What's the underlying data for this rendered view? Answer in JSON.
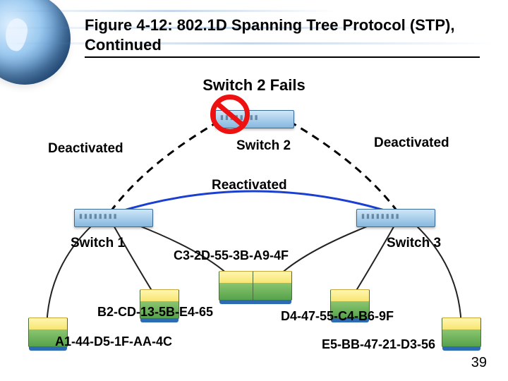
{
  "title": "Figure 4-12: 802.1D Spanning Tree Protocol (STP), Continued",
  "heading": "Switch 2 Fails",
  "labels": {
    "deactivated_left": "Deactivated",
    "deactivated_right": "Deactivated",
    "reactivated": "Reactivated",
    "switch1": "Switch 1",
    "switch2": "Switch 2",
    "switch3": "Switch 3"
  },
  "mac": {
    "center": "C3-2D-55-3B-A9-4F",
    "left_mid": "B2-CD-13-5B-E4-65",
    "right_mid": "D4-47-55-C4-B6-9F",
    "left_low": "A1-44-D5-1F-AA-4C",
    "right_low": "E5-BB-47-21-D3-56"
  },
  "page_number": "39",
  "colors": {
    "dashed": "#000000",
    "reactivated_arc": "#1a3fd1",
    "host_line": "#222222"
  }
}
